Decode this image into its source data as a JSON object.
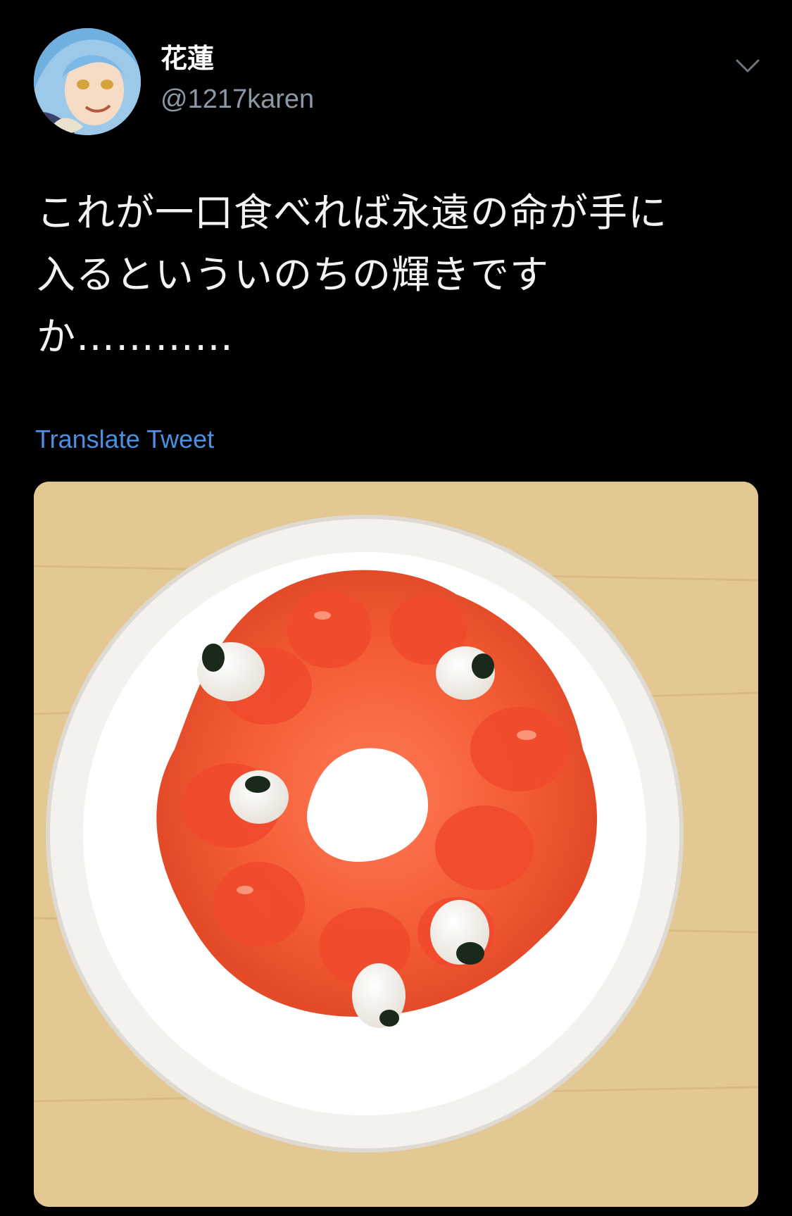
{
  "tweet": {
    "author": {
      "name": "花蓮",
      "handle": "@1217karen"
    },
    "text": "これが一口食べれば永遠の命が手に\n入るといういのちの輝きです\nか…………",
    "translate_label": "Translate Tweet",
    "media": {
      "type": "photo",
      "icon": "photo-icon"
    }
  },
  "icons": {
    "more": "chevron-down-icon",
    "avatar": "avatar"
  },
  "colors": {
    "background": "#000000",
    "link": "#4a90e2",
    "secondary_text": "#8b98a5"
  }
}
